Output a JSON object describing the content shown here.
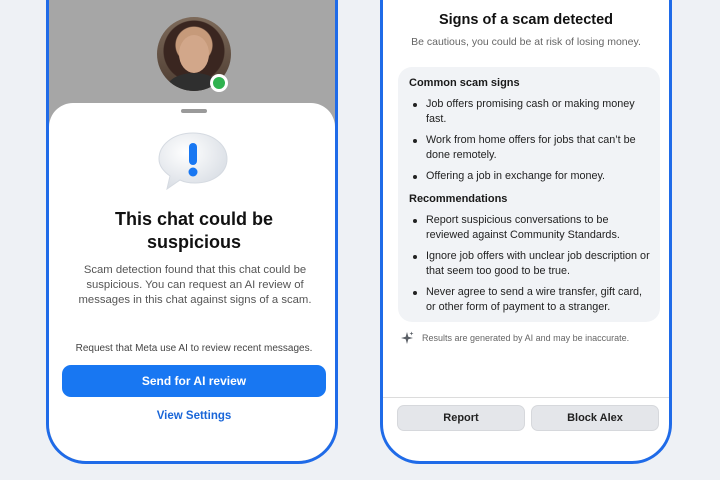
{
  "left_screen": {
    "sheet": {
      "title": "This chat could be suspicious",
      "body": "Scam detection found that this chat could be suspicious. You can request an AI review of messages in this chat against signs of a scam.",
      "request_note": "Request that Meta use AI to review recent messages.",
      "primary_button": "Send for AI review",
      "secondary_link": "View Settings"
    },
    "colors": {
      "accent": "#1877f2",
      "online": "#2fb24f"
    }
  },
  "right_screen": {
    "title": "Signs of a scam detected",
    "subtitle": "Be cautious, you could be at risk of losing money.",
    "common_signs": {
      "heading": "Common scam signs",
      "items": [
        "Job offers promising cash or making money fast.",
        "Work from home offers for jobs that can’t be done remotely.",
        "Offering a job in exchange for money."
      ]
    },
    "recommendations": {
      "heading": "Recommendations",
      "items": [
        "Report suspicious conversations to be reviewed against Community Standards.",
        "Ignore job offers with unclear job description or that seem too good to be true.",
        "Never agree to send a wire transfer, gift card, or other form of payment to a stranger."
      ]
    },
    "ai_note": "Results are generated by AI and may be inaccurate.",
    "buttons": {
      "report": "Report",
      "block": "Block Alex"
    }
  }
}
